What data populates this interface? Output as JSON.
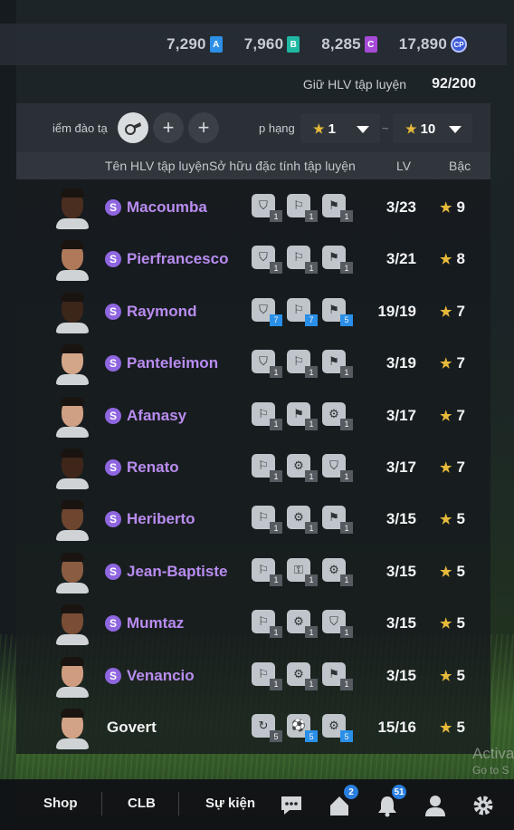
{
  "currency": [
    {
      "value": "7,290",
      "badge": "A",
      "color": "#2d8fe6"
    },
    {
      "value": "7,960",
      "badge": "B",
      "color": "#1fb8a3"
    },
    {
      "value": "8,285",
      "badge": "C",
      "color": "#a64ad8"
    },
    {
      "value": "17,890",
      "badge": "CP",
      "color": "#3c5ad8"
    }
  ],
  "capacity": {
    "label": "Giữ HLV tập luyện",
    "value": "92/200"
  },
  "filter": {
    "training_label": "iểm đào tạ",
    "rank_label": "p hạng",
    "rank_from": "1",
    "rank_to": "10",
    "tilde": "~"
  },
  "headers": {
    "name": "Tên HLV tập luyện",
    "traits": "Sở hữu đặc tính tập luyện",
    "lv": "LV",
    "rank": "Bậc"
  },
  "coaches": [
    {
      "name": "Macoumba",
      "special": true,
      "lv": "3/23",
      "rank": "9",
      "skin": "#4a2e1f",
      "traits": [
        {
          "icon": "⛉",
          "lvl": "1",
          "hi": false
        },
        {
          "icon": "⚐",
          "lvl": "1",
          "hi": false
        },
        {
          "icon": "⚑",
          "lvl": "1",
          "hi": false
        }
      ]
    },
    {
      "name": "Pierfrancesco",
      "special": true,
      "lv": "3/21",
      "rank": "8",
      "skin": "#b07a5a",
      "traits": [
        {
          "icon": "⛉",
          "lvl": "1",
          "hi": false
        },
        {
          "icon": "⚐",
          "lvl": "1",
          "hi": false
        },
        {
          "icon": "⚑",
          "lvl": "1",
          "hi": false
        }
      ]
    },
    {
      "name": "Raymond",
      "special": true,
      "lv": "19/19",
      "rank": "7",
      "skin": "#3c2519",
      "traits": [
        {
          "icon": "⛉",
          "lvl": "7",
          "hi": true
        },
        {
          "icon": "⚐",
          "lvl": "7",
          "hi": true
        },
        {
          "icon": "⚑",
          "lvl": "5",
          "hi": true
        }
      ]
    },
    {
      "name": "Panteleimon",
      "special": true,
      "lv": "3/19",
      "rank": "7",
      "skin": "#d4a689",
      "traits": [
        {
          "icon": "⛉",
          "lvl": "1",
          "hi": false
        },
        {
          "icon": "⚐",
          "lvl": "1",
          "hi": false
        },
        {
          "icon": "⚑",
          "lvl": "1",
          "hi": false
        }
      ]
    },
    {
      "name": "Afanasy",
      "special": true,
      "lv": "3/17",
      "rank": "7",
      "skin": "#d0a084",
      "traits": [
        {
          "icon": "⚐",
          "lvl": "1",
          "hi": false
        },
        {
          "icon": "⚑",
          "lvl": "1",
          "hi": false
        },
        {
          "icon": "⚙",
          "lvl": "1",
          "hi": false
        }
      ]
    },
    {
      "name": "Renato",
      "special": true,
      "lv": "3/17",
      "rank": "7",
      "skin": "#3e271a",
      "traits": [
        {
          "icon": "⚐",
          "lvl": "1",
          "hi": false
        },
        {
          "icon": "⚙",
          "lvl": "1",
          "hi": false
        },
        {
          "icon": "⛉",
          "lvl": "1",
          "hi": false
        }
      ]
    },
    {
      "name": "Heriberto",
      "special": true,
      "lv": "3/15",
      "rank": "5",
      "skin": "#6e4630",
      "traits": [
        {
          "icon": "⚐",
          "lvl": "1",
          "hi": false
        },
        {
          "icon": "⚙",
          "lvl": "1",
          "hi": false
        },
        {
          "icon": "⚑",
          "lvl": "1",
          "hi": false
        }
      ]
    },
    {
      "name": "Jean-Baptiste",
      "special": true,
      "lv": "3/15",
      "rank": "5",
      "skin": "#8a5c42",
      "traits": [
        {
          "icon": "⚐",
          "lvl": "1",
          "hi": false
        },
        {
          "icon": "⚿",
          "lvl": "1",
          "hi": false
        },
        {
          "icon": "⚙",
          "lvl": "1",
          "hi": false
        }
      ]
    },
    {
      "name": "Mumtaz",
      "special": true,
      "lv": "3/15",
      "rank": "5",
      "skin": "#7a4e36",
      "traits": [
        {
          "icon": "⚐",
          "lvl": "1",
          "hi": false
        },
        {
          "icon": "⚙",
          "lvl": "1",
          "hi": false
        },
        {
          "icon": "⛉",
          "lvl": "1",
          "hi": false
        }
      ]
    },
    {
      "name": "Venancio",
      "special": true,
      "lv": "3/15",
      "rank": "5",
      "skin": "#cf9c80",
      "traits": [
        {
          "icon": "⚐",
          "lvl": "1",
          "hi": false
        },
        {
          "icon": "⚙",
          "lvl": "1",
          "hi": false
        },
        {
          "icon": "⚑",
          "lvl": "1",
          "hi": false
        }
      ]
    },
    {
      "name": "Govert",
      "special": false,
      "lv": "15/16",
      "rank": "5",
      "skin": "#d2a386",
      "traits": [
        {
          "icon": "↻",
          "lvl": "5",
          "hi": false
        },
        {
          "icon": "⚽",
          "lvl": "5",
          "hi": true
        },
        {
          "icon": "⚙",
          "lvl": "5",
          "hi": true
        }
      ]
    }
  ],
  "nav": {
    "shop": "Shop",
    "club": "CLB",
    "events": "Sự kiện",
    "home_count": "2",
    "bell_count": "51"
  },
  "watermark": {
    "line1": "Activa",
    "line2": "Go to S"
  }
}
